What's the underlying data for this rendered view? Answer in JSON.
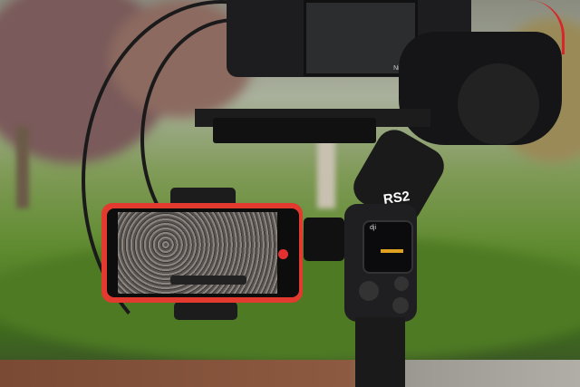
{
  "photo": {
    "gimbal_label": "RS2",
    "gimbal_brand": "dji",
    "camera_brand": "Nikon",
    "accent_color": "#d8262a",
    "phone_case_color": "#e23a2e"
  }
}
